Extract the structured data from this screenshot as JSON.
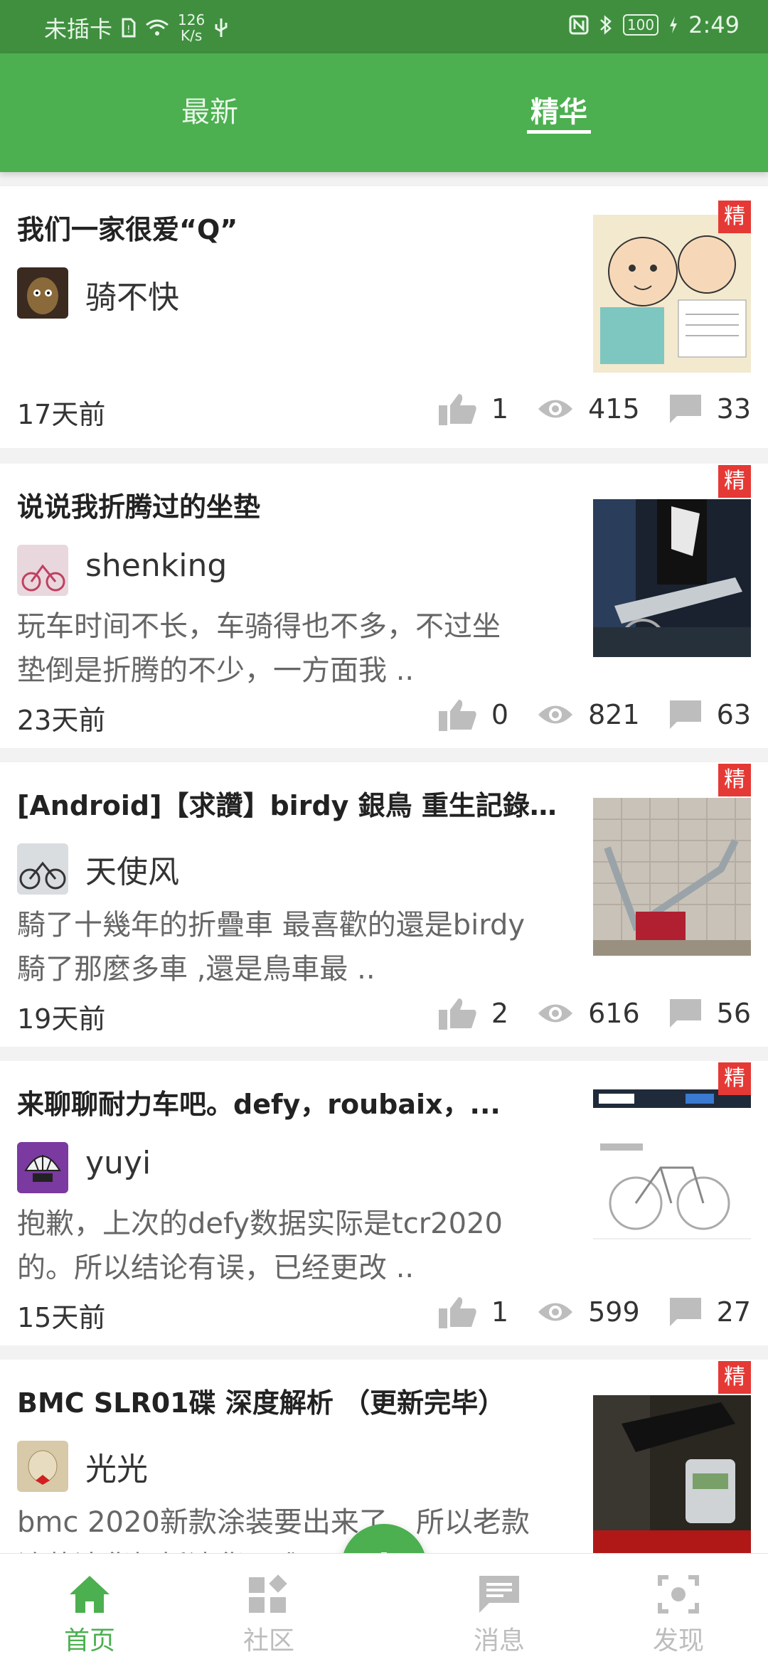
{
  "status_bar": {
    "carrier": "未插卡",
    "speed_value": "126",
    "speed_unit": "K/s",
    "battery": "100",
    "time": "2:49"
  },
  "tabs": [
    {
      "label": "最新",
      "active": false
    },
    {
      "label": "精华",
      "active": true
    }
  ],
  "posts": [
    {
      "title": "我们一家很爱“Q”",
      "author": "骑不快",
      "excerpt_line1": "",
      "excerpt_line2": "",
      "time": "17天前",
      "likes": "1",
      "views": "415",
      "comments": "33",
      "badge": "精"
    },
    {
      "title": "说说我折腾过的坐垫",
      "author": "shenking",
      "excerpt_line1": "玩车时间不长，车骑得也不多，不过坐",
      "excerpt_line2": "垫倒是折腾的不少，一方面我 ..",
      "time": "23天前",
      "likes": "0",
      "views": "821",
      "comments": "63",
      "badge": "精"
    },
    {
      "title": "[Android]【求讚】birdy 銀鳥 重生記錄芳...",
      "author": "天使风",
      "excerpt_line1": "騎了十幾年的折疊車 最喜歡的還是birdy",
      "excerpt_line2": "騎了那麼多車 ,還是鳥車最 ..",
      "time": "19天前",
      "likes": "2",
      "views": "616",
      "comments": "56",
      "badge": "精"
    },
    {
      "title": "来聊聊耐力车吧。defy，roubaix，...",
      "author": "yuyi",
      "excerpt_line1": "抱歉，上次的defy数据实际是tcr2020",
      "excerpt_line2": "的。所以结论有误，已经更改 ..",
      "time": "15天前",
      "likes": "1",
      "views": "599",
      "comments": "27",
      "badge": "精"
    },
    {
      "title": "BMC SLR01碟 深度解析 （更新完毕）",
      "author": "光光",
      "excerpt_line1": "bmc 2020新款涂装要出来了，所以老款",
      "excerpt_line2": "涂装清货打折清货甩唯...",
      "time": "",
      "likes": "",
      "views": "",
      "comments": "",
      "badge": "精"
    }
  ],
  "nav": [
    {
      "label": "首页",
      "icon": "home-icon",
      "active": true
    },
    {
      "label": "社区",
      "icon": "community-icon",
      "active": false
    },
    {
      "label": "消息",
      "icon": "message-icon",
      "active": false
    },
    {
      "label": "发现",
      "icon": "scan-icon",
      "active": false
    }
  ],
  "colors": {
    "primary": "#4caf50",
    "status_bar": "#3f8f3f",
    "badge": "#e53935"
  }
}
